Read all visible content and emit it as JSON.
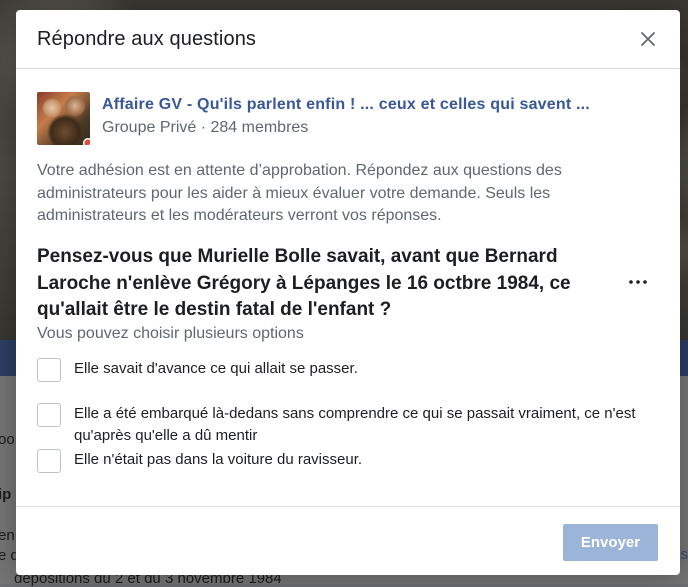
{
  "modal": {
    "title": "Répondre aux questions",
    "group": {
      "name": "Affaire GV - Qu'ils parlent enfin ! ... ceux et celles qui savent ...",
      "meta": "Groupe Privé · 284 membres"
    },
    "intro": "Votre adhésion est en attente d’approbation. Répondez aux questions des administrateurs pour les aider à mieux évaluer votre demande. Seuls les administrateurs et les modérateurs verront vos réponses.",
    "question": "Pensez-vous que Murielle Bolle savait, avant que Bernard Laroche n'enlève Grégory à Lépanges le 16 octbre 1984, ce qu'allait être le destin fatal de l'enfant ?",
    "hint": "Vous pouvez choisir plusieurs options",
    "options": [
      {
        "label": "Elle savait d'avance ce qui allait se passer.",
        "checked": false
      },
      {
        "label": "Elle a été embarqué là-dedans sans comprendre ce qui se passait vraiment, ce n'est qu'après qu'elle a dû mentir",
        "checked": false
      },
      {
        "label": "Elle n'était pas dans la voiture du ravisseur.",
        "checked": false
      }
    ],
    "send_label": "Envoyer"
  },
  "background": {
    "text_partial_1": "oo",
    "text_partial_2": "ip",
    "text_partial_3": "en",
    "text_partial_4": "e d",
    "text_partial_5": "dépositions du 2 et du 3 novembre 1984",
    "text_partial_right": "as"
  },
  "colors": {
    "accent": "#385898",
    "button_disabled": "#9cb4d8",
    "overlay": "#757575"
  }
}
